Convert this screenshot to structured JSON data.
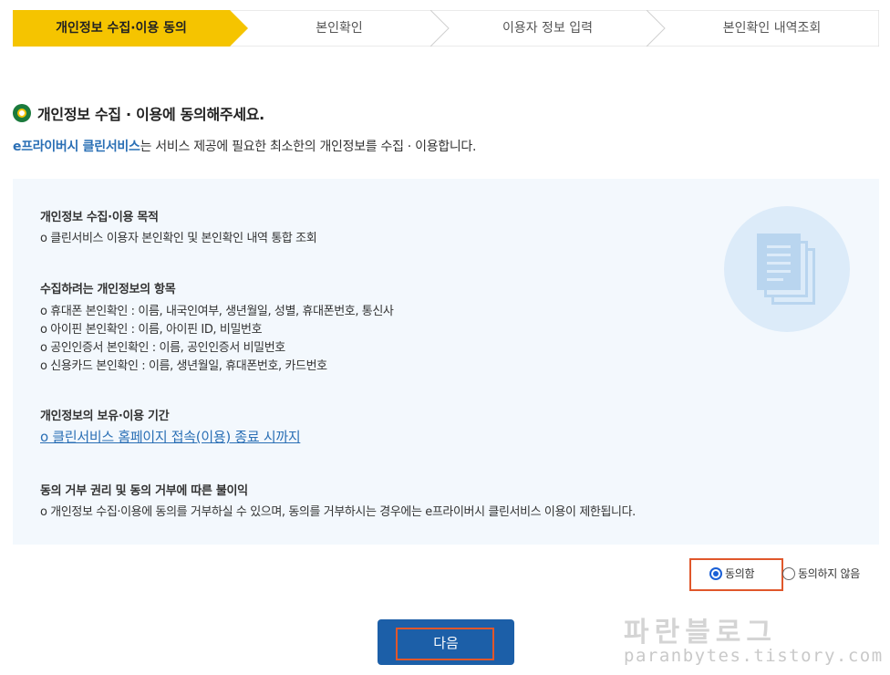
{
  "stepper": {
    "steps": [
      {
        "label": "개인정보 수집·이용 동의",
        "active": true
      },
      {
        "label": "본인확인",
        "active": false
      },
      {
        "label": "이용자 정보 입력",
        "active": false
      },
      {
        "label": "본인확인 내역조회",
        "active": false
      }
    ],
    "active_color": "#f5c400"
  },
  "heading": {
    "icon": "circle-bullet-icon",
    "text": "개인정보 수집 · 이용에 동의해주세요."
  },
  "intro": {
    "brand": "e프라이버시 클린서비스",
    "text": "는 서비스 제공에 필요한 최소한의 개인정보를 수집 · 이용합니다."
  },
  "info": {
    "illustration_icon": "document-stack-icon",
    "purpose": {
      "title": "개인정보 수집·이용 목적",
      "lines": [
        "o 클린서비스 이용자 본인확인 및 본인확인 내역 통합 조회"
      ]
    },
    "items": {
      "title": "수집하려는 개인정보의 항목",
      "lines": [
        "o 휴대폰 본인확인 : 이름, 내국인여부, 생년월일, 성별, 휴대폰번호, 통신사",
        "o 아이핀 본인확인 : 이름, 아이핀 ID, 비밀번호",
        "o 공인인증서 본인확인 : 이름, 공인인증서 비밀번호",
        "o 신용카드 본인확인 : 이름, 생년월일, 휴대폰번호, 카드번호"
      ]
    },
    "retention": {
      "title": "개인정보의 보유·이용 기간",
      "link": "o 클린서비스 홈페이지 접속(이용) 종료 시까지"
    },
    "refusal": {
      "title": "동의 거부 권리 및 동의 거부에 따른 불이익",
      "lines": [
        "o 개인정보 수집·이용에 동의를 거부하실 수 있으며, 동의를 거부하시는 경우에는 e프라이버시 클린서비스 이용이 제한됩니다."
      ]
    }
  },
  "consent": {
    "agree_label": "동의함",
    "disagree_label": "동의하지 않음",
    "selected": "agree"
  },
  "next_button": {
    "label": "다음"
  },
  "watermark": {
    "title": "파란블로그",
    "url": "paranbytes.tistory.com"
  },
  "colors": {
    "accent": "#1c5fa8",
    "brand_text": "#2a6fb5",
    "highlight": "#e0572b",
    "box_bg": "#f3f8fd"
  }
}
